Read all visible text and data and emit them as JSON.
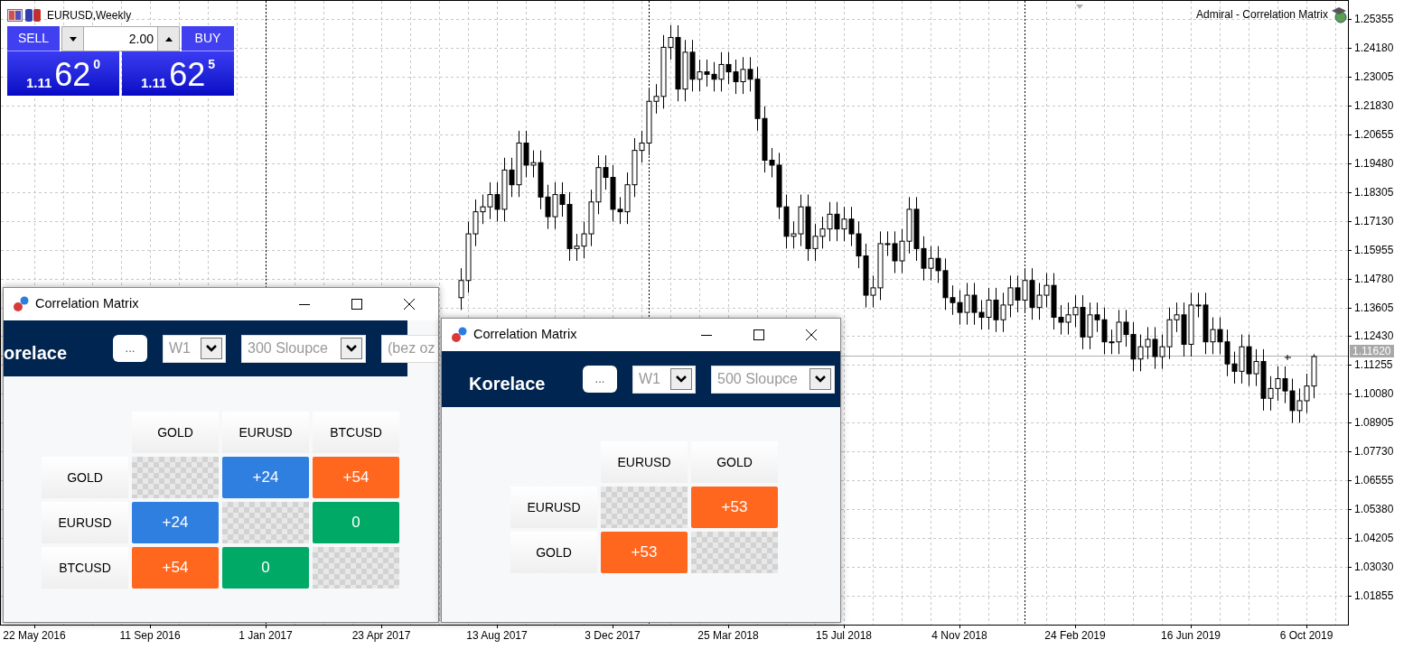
{
  "chart": {
    "symbol_title": "EURUSD,Weekly",
    "indicator_title": "Admiral - Correlation Matrix",
    "current_price": "1.11620",
    "chart_data": {
      "type": "candlestick",
      "ylim": [
        1.00678,
        1.26091
      ],
      "grid": true,
      "ref_lines": [
        {
          "axis": "y",
          "value": 1.1162
        }
      ],
      "categories": [
        "22 May 2016",
        null,
        null,
        null,
        null,
        null,
        null,
        null,
        null,
        null,
        null,
        null,
        null,
        null,
        null,
        null,
        "11 Sep 2016",
        null,
        null,
        null,
        null,
        null,
        null,
        null,
        null,
        null,
        null,
        null,
        null,
        null,
        null,
        null,
        "1 Jan 2017",
        null,
        null,
        null,
        null,
        null,
        null,
        null,
        null,
        null,
        null,
        null,
        null,
        null,
        null,
        null,
        "23 Apr 2017",
        null,
        null,
        null,
        null,
        null,
        null,
        null,
        null,
        null,
        null,
        null,
        null,
        null,
        null,
        null,
        "13 Aug 2017",
        null,
        null,
        null,
        null,
        null,
        null,
        null,
        null,
        null,
        null,
        null,
        null,
        null,
        null,
        null,
        "3 Dec 2017",
        null,
        null,
        null,
        null,
        null,
        null,
        null,
        null,
        null,
        null,
        null,
        null,
        null,
        null,
        null,
        "25 Mar 2018",
        null,
        null,
        null,
        null,
        null,
        null,
        null,
        null,
        null,
        null,
        null,
        null,
        null,
        null,
        null,
        "15 Jul 2018",
        null,
        null,
        null,
        null,
        null,
        null,
        null,
        null,
        null,
        null,
        null,
        null,
        null,
        null,
        null,
        "4 Nov 2018",
        null,
        null,
        null,
        null,
        null,
        null,
        null,
        null,
        null,
        null,
        null,
        null,
        null,
        null,
        null,
        "24 Feb 2019",
        null,
        null,
        null,
        null,
        null,
        null,
        null,
        null,
        null,
        null,
        null,
        null,
        null,
        null,
        null,
        "16 Jun 2019",
        null,
        null,
        null,
        null,
        null,
        null,
        null,
        null,
        null,
        null,
        null,
        null,
        null,
        null,
        null,
        "6 Oct 2019",
        null,
        null,
        null,
        null,
        null
      ],
      "yticks": [
        {
          "value": 1.25355,
          "label": "1.25355"
        },
        {
          "value": 1.2418,
          "label": "1.24180"
        },
        {
          "value": 1.23005,
          "label": "1.23005"
        },
        {
          "value": 1.2183,
          "label": "1.21830"
        },
        {
          "value": 1.20655,
          "label": "1.20655"
        },
        {
          "value": 1.1948,
          "label": "1.19480"
        },
        {
          "value": 1.18305,
          "label": "1.18305"
        },
        {
          "value": 1.1713,
          "label": "1.17130"
        },
        {
          "value": 1.15955,
          "label": "1.15955"
        },
        {
          "value": 1.1478,
          "label": "1.14780"
        },
        {
          "value": 1.13605,
          "label": "1.13605"
        },
        {
          "value": 1.1243,
          "label": "1.12430"
        },
        {
          "value": 1.11255,
          "label": "1.11255"
        },
        {
          "value": 1.1008,
          "label": "1.10080"
        },
        {
          "value": 1.08905,
          "label": "1.08905"
        },
        {
          "value": 1.0773,
          "label": "1.07730"
        },
        {
          "value": 1.06555,
          "label": "1.06555"
        },
        {
          "value": 1.0538,
          "label": "1.05380"
        },
        {
          "value": 1.04205,
          "label": "1.04205"
        },
        {
          "value": 1.0303,
          "label": "1.03030"
        },
        {
          "value": 1.01855,
          "label": "1.01855"
        }
      ],
      "ohlc": [
        null,
        null,
        null,
        null,
        null,
        null,
        null,
        null,
        null,
        null,
        null,
        null,
        null,
        null,
        null,
        null,
        null,
        null,
        null,
        null,
        null,
        null,
        null,
        null,
        null,
        null,
        null,
        null,
        null,
        null,
        null,
        null,
        null,
        null,
        null,
        null,
        null,
        null,
        null,
        null,
        null,
        null,
        null,
        null,
        null,
        null,
        null,
        null,
        null,
        null,
        null,
        null,
        null,
        null,
        null,
        null,
        null,
        null,
        null,
        [
          1.14,
          1.152,
          1.135,
          1.147
        ],
        [
          1.147,
          1.171,
          1.142,
          1.166
        ],
        [
          1.166,
          1.18,
          1.161,
          1.175
        ],
        [
          1.175,
          1.182,
          1.17,
          1.177
        ],
        [
          1.177,
          1.187,
          1.172,
          1.182
        ],
        [
          1.182,
          1.187,
          1.171,
          1.176
        ],
        [
          1.176,
          1.197,
          1.171,
          1.192
        ],
        [
          1.192,
          1.197,
          1.181,
          1.186
        ],
        [
          1.186,
          1.208,
          1.181,
          1.203
        ],
        [
          1.203,
          1.208,
          1.189,
          1.194
        ],
        [
          1.194,
          1.2,
          1.189,
          1.195
        ],
        [
          1.195,
          1.2,
          1.176,
          1.181
        ],
        [
          1.181,
          1.186,
          1.168,
          1.173
        ],
        [
          1.173,
          1.187,
          1.168,
          1.182
        ],
        [
          1.182,
          1.187,
          1.173,
          1.178
        ],
        [
          1.178,
          1.183,
          1.155,
          1.16
        ],
        [
          1.16,
          1.166,
          1.155,
          1.161
        ],
        [
          1.161,
          1.171,
          1.156,
          1.166
        ],
        [
          1.166,
          1.184,
          1.161,
          1.179
        ],
        [
          1.179,
          1.198,
          1.174,
          1.193
        ],
        [
          1.193,
          1.198,
          1.184,
          1.189
        ],
        [
          1.189,
          1.194,
          1.171,
          1.176
        ],
        [
          1.176,
          1.181,
          1.17,
          1.175
        ],
        [
          1.175,
          1.191,
          1.17,
          1.186
        ],
        [
          1.186,
          1.205,
          1.181,
          1.2
        ],
        [
          1.2,
          1.208,
          1.195,
          1.203
        ],
        [
          1.203,
          1.225,
          1.198,
          1.22
        ],
        [
          1.22,
          1.227,
          1.215,
          1.222
        ],
        [
          1.222,
          1.247,
          1.217,
          1.242
        ],
        [
          1.242,
          1.251,
          1.237,
          1.246
        ],
        [
          1.246,
          1.251,
          1.22,
          1.225
        ],
        [
          1.225,
          1.245,
          1.22,
          1.24
        ],
        [
          1.24,
          1.245,
          1.224,
          1.229
        ],
        [
          1.229,
          1.237,
          1.224,
          1.232
        ],
        [
          1.232,
          1.237,
          1.226,
          1.231
        ],
        [
          1.231,
          1.236,
          1.224,
          1.229
        ],
        [
          1.229,
          1.24,
          1.224,
          1.235
        ],
        [
          1.235,
          1.24,
          1.227,
          1.232
        ],
        [
          1.232,
          1.237,
          1.223,
          1.228
        ],
        [
          1.228,
          1.238,
          1.223,
          1.233
        ],
        [
          1.233,
          1.238,
          1.224,
          1.229
        ],
        [
          1.229,
          1.234,
          1.208,
          1.213
        ],
        [
          1.213,
          1.218,
          1.191,
          1.196
        ],
        [
          1.196,
          1.201,
          1.189,
          1.194
        ],
        [
          1.194,
          1.199,
          1.172,
          1.177
        ],
        [
          1.177,
          1.182,
          1.16,
          1.165
        ],
        [
          1.165,
          1.171,
          1.16,
          1.166
        ],
        [
          1.166,
          1.182,
          1.161,
          1.177
        ],
        [
          1.177,
          1.182,
          1.155,
          1.16
        ],
        [
          1.16,
          1.17,
          1.155,
          1.165
        ],
        [
          1.165,
          1.173,
          1.16,
          1.168
        ],
        [
          1.168,
          1.179,
          1.163,
          1.174
        ],
        [
          1.174,
          1.179,
          1.163,
          1.168
        ],
        [
          1.168,
          1.177,
          1.163,
          1.172
        ],
        [
          1.172,
          1.177,
          1.161,
          1.166
        ],
        [
          1.166,
          1.171,
          1.152,
          1.157
        ],
        [
          1.157,
          1.162,
          1.136,
          1.141
        ],
        [
          1.141,
          1.149,
          1.136,
          1.144
        ],
        [
          1.144,
          1.167,
          1.139,
          1.162
        ],
        [
          1.162,
          1.167,
          1.157,
          1.162
        ],
        [
          1.162,
          1.167,
          1.15,
          1.155
        ],
        [
          1.155,
          1.168,
          1.15,
          1.163
        ],
        [
          1.163,
          1.181,
          1.158,
          1.176
        ],
        [
          1.176,
          1.181,
          1.155,
          1.16
        ],
        [
          1.16,
          1.165,
          1.147,
          1.152
        ],
        [
          1.152,
          1.161,
          1.147,
          1.156
        ],
        [
          1.156,
          1.161,
          1.146,
          1.151
        ],
        [
          1.151,
          1.156,
          1.135,
          1.14
        ],
        [
          1.14,
          1.145,
          1.133,
          1.138
        ],
        [
          1.138,
          1.143,
          1.129,
          1.134
        ],
        [
          1.134,
          1.146,
          1.129,
          1.141
        ],
        [
          1.141,
          1.146,
          1.129,
          1.134
        ],
        [
          1.134,
          1.139,
          1.127,
          1.132
        ],
        [
          1.132,
          1.144,
          1.127,
          1.139
        ],
        [
          1.139,
          1.144,
          1.126,
          1.131
        ],
        [
          1.131,
          1.142,
          1.126,
          1.137
        ],
        [
          1.137,
          1.149,
          1.132,
          1.144
        ],
        [
          1.144,
          1.149,
          1.134,
          1.139
        ],
        [
          1.139,
          1.152,
          1.134,
          1.147
        ],
        [
          1.147,
          1.152,
          1.131,
          1.136
        ],
        [
          1.136,
          1.146,
          1.131,
          1.141
        ],
        [
          1.141,
          1.15,
          1.136,
          1.145
        ],
        [
          1.145,
          1.15,
          1.127,
          1.132
        ],
        [
          1.132,
          1.137,
          1.125,
          1.13
        ],
        [
          1.13,
          1.138,
          1.125,
          1.133
        ],
        [
          1.133,
          1.141,
          1.128,
          1.136
        ],
        [
          1.136,
          1.141,
          1.119,
          1.124
        ],
        [
          1.124,
          1.138,
          1.119,
          1.133
        ],
        [
          1.133,
          1.138,
          1.126,
          1.131
        ],
        [
          1.131,
          1.136,
          1.117,
          1.122
        ],
        [
          1.122,
          1.127,
          1.117,
          1.122
        ],
        [
          1.122,
          1.135,
          1.117,
          1.13
        ],
        [
          1.13,
          1.135,
          1.12,
          1.125
        ],
        [
          1.125,
          1.13,
          1.11,
          1.115
        ],
        [
          1.115,
          1.125,
          1.11,
          1.12
        ],
        [
          1.12,
          1.128,
          1.115,
          1.123
        ],
        [
          1.123,
          1.128,
          1.111,
          1.116
        ],
        [
          1.116,
          1.125,
          1.111,
          1.12
        ],
        [
          1.12,
          1.136,
          1.115,
          1.131
        ],
        [
          1.131,
          1.138,
          1.126,
          1.133
        ],
        [
          1.133,
          1.138,
          1.116,
          1.121
        ],
        [
          1.121,
          1.142,
          1.116,
          1.137
        ],
        [
          1.137,
          1.142,
          1.132,
          1.137
        ],
        [
          1.137,
          1.142,
          1.117,
          1.122
        ],
        [
          1.122,
          1.132,
          1.117,
          1.127
        ],
        [
          1.127,
          1.132,
          1.117,
          1.122
        ],
        [
          1.122,
          1.127,
          1.108,
          1.113
        ],
        [
          1.113,
          1.118,
          1.105,
          1.11
        ],
        [
          1.11,
          1.125,
          1.105,
          1.12
        ],
        [
          1.12,
          1.125,
          1.104,
          1.109
        ],
        [
          1.109,
          1.119,
          1.104,
          1.114
        ],
        [
          1.114,
          1.119,
          1.094,
          1.099
        ],
        [
          1.099,
          1.108,
          1.094,
          1.103
        ],
        [
          1.103,
          1.112,
          1.098,
          1.107
        ],
        [
          1.107,
          1.112,
          1.097,
          1.102
        ],
        [
          1.102,
          1.107,
          1.089,
          1.094
        ],
        [
          1.094,
          1.103,
          1.089,
          1.098
        ],
        [
          1.098,
          1.109,
          1.093,
          1.104
        ],
        [
          1.104,
          1.117,
          1.099,
          1.116
        ],
        null,
        null,
        null,
        null
      ]
    }
  },
  "trade_panel": {
    "volume": "2.00",
    "sell": {
      "label": "SELL",
      "price_prefix": "1.11",
      "price_main": "62",
      "price_sup": "0"
    },
    "buy": {
      "label": "BUY",
      "price_prefix": "1.11",
      "price_main": "62",
      "price_sup": "5"
    }
  },
  "windows": [
    {
      "title": "Correlation Matrix",
      "header": {
        "title": "orelace",
        "options_button": "...",
        "fields": [
          {
            "kind": "select",
            "value": "W1"
          },
          {
            "kind": "select",
            "value": "300 Sloupce"
          },
          {
            "kind": "text",
            "value": "(bez oz"
          }
        ]
      },
      "matrix": {
        "columns": [
          "GOLD",
          "EURUSD",
          "BTCUSD"
        ],
        "rows": [
          {
            "label": "GOLD",
            "cells": [
              {
                "kind": "empty"
              },
              {
                "kind": "value",
                "value": "+24",
                "color": "#2f7fe0"
              },
              {
                "kind": "value",
                "value": "+54",
                "color": "#ff671f"
              }
            ]
          },
          {
            "label": "EURUSD",
            "cells": [
              {
                "kind": "value",
                "value": "+24",
                "color": "#2f7fe0"
              },
              {
                "kind": "empty"
              },
              {
                "kind": "value",
                "value": "0",
                "color": "#00aa66"
              }
            ]
          },
          {
            "label": "BTCUSD",
            "cells": [
              {
                "kind": "value",
                "value": "+54",
                "color": "#ff671f"
              },
              {
                "kind": "value",
                "value": "0",
                "color": "#00aa66"
              },
              {
                "kind": "empty"
              }
            ]
          }
        ]
      }
    },
    {
      "title": "Correlation Matrix",
      "header": {
        "title": "Korelace",
        "options_button": "...",
        "fields": [
          {
            "kind": "select",
            "value": "W1"
          },
          {
            "kind": "select",
            "value": "500 Sloupce"
          }
        ]
      },
      "matrix": {
        "columns": [
          "EURUSD",
          "GOLD"
        ],
        "rows": [
          {
            "label": "EURUSD",
            "cells": [
              {
                "kind": "empty"
              },
              {
                "kind": "value",
                "value": "+53",
                "color": "#ff671f"
              }
            ]
          },
          {
            "label": "GOLD",
            "cells": [
              {
                "kind": "value",
                "value": "+53",
                "color": "#ff671f"
              },
              {
                "kind": "empty"
              }
            ]
          }
        ]
      }
    }
  ]
}
